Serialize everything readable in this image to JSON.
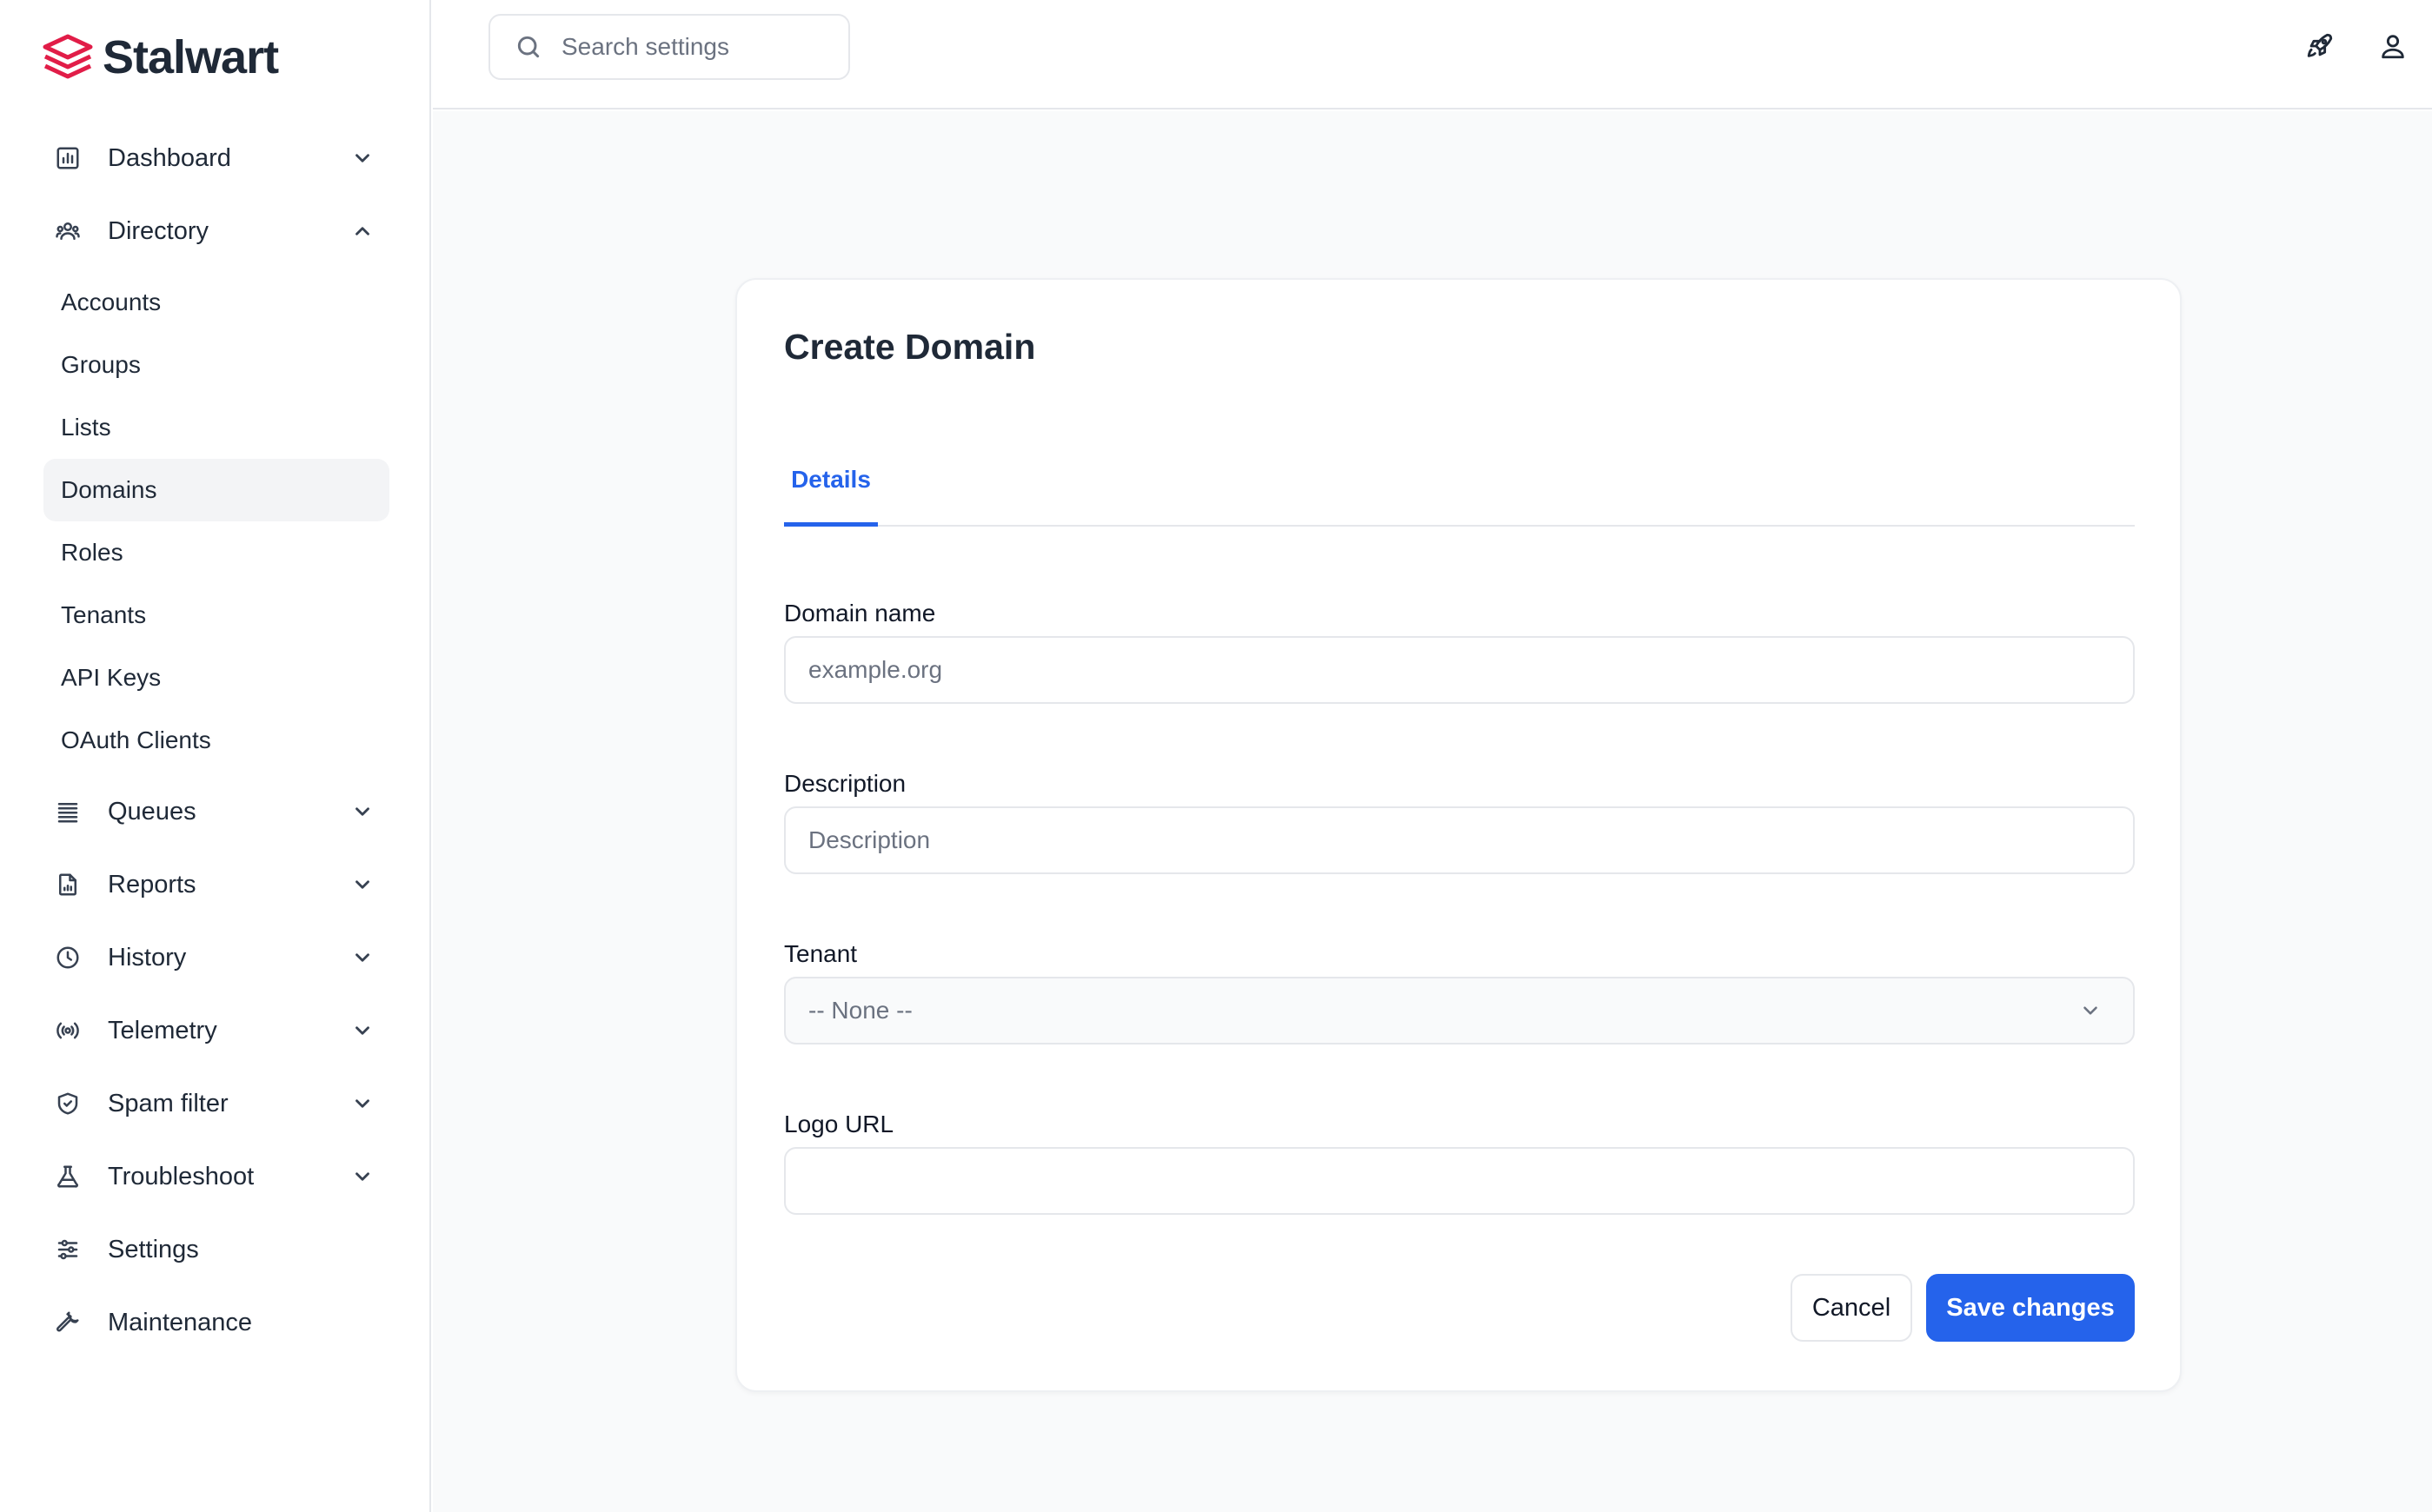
{
  "brand": {
    "name": "Stalwart",
    "logo_color": "#e11d48"
  },
  "search": {
    "placeholder": "Search settings"
  },
  "sidebar": {
    "items": [
      {
        "label": "Dashboard",
        "icon": "chart-icon",
        "expandable": true,
        "expanded": false
      },
      {
        "label": "Directory",
        "icon": "users-icon",
        "expandable": true,
        "expanded": true,
        "children": [
          "Accounts",
          "Groups",
          "Lists",
          "Domains",
          "Roles",
          "Tenants",
          "API Keys",
          "OAuth Clients"
        ],
        "active_child": "Domains"
      },
      {
        "label": "Queues",
        "icon": "queue-icon",
        "expandable": true,
        "expanded": false
      },
      {
        "label": "Reports",
        "icon": "report-icon",
        "expandable": true,
        "expanded": false
      },
      {
        "label": "History",
        "icon": "clock-icon",
        "expandable": true,
        "expanded": false
      },
      {
        "label": "Telemetry",
        "icon": "broadcast-icon",
        "expandable": true,
        "expanded": false
      },
      {
        "label": "Spam filter",
        "icon": "shield-icon",
        "expandable": true,
        "expanded": false
      },
      {
        "label": "Troubleshoot",
        "icon": "flask-icon",
        "expandable": true,
        "expanded": false
      },
      {
        "label": "Settings",
        "icon": "sliders-icon",
        "expandable": false
      },
      {
        "label": "Maintenance",
        "icon": "wrench-icon",
        "expandable": false
      }
    ]
  },
  "header": {
    "icons": [
      "rocket-icon",
      "user-icon"
    ]
  },
  "form": {
    "title": "Create Domain",
    "tabs": [
      {
        "label": "Details",
        "active": true
      }
    ],
    "fields": {
      "domain_name": {
        "label": "Domain name",
        "placeholder": "example.org",
        "value": ""
      },
      "description": {
        "label": "Description",
        "placeholder": "Description",
        "value": ""
      },
      "tenant": {
        "label": "Tenant",
        "selected": "-- None --"
      },
      "logo_url": {
        "label": "Logo URL",
        "placeholder": "",
        "value": ""
      }
    },
    "buttons": {
      "cancel": "Cancel",
      "save": "Save changes"
    }
  },
  "colors": {
    "accent": "#2563eb",
    "active_nav_bg": "#f3f4f6",
    "main_bg": "#f9fafb"
  }
}
